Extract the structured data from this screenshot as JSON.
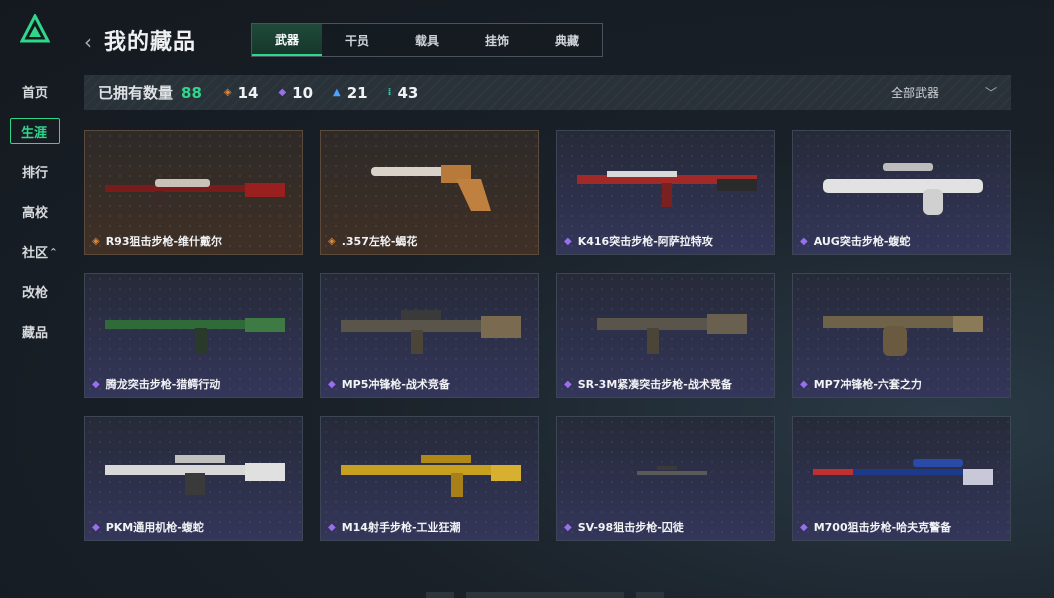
{
  "header": {
    "title": "我的藏品",
    "tabs": [
      {
        "label": "武器",
        "active": true
      },
      {
        "label": "干员",
        "active": false
      },
      {
        "label": "载具",
        "active": false
      },
      {
        "label": "挂饰",
        "active": false
      },
      {
        "label": "典藏",
        "active": false
      }
    ]
  },
  "sidebar": {
    "items": [
      {
        "label": "首页"
      },
      {
        "label": "生涯",
        "active": true
      },
      {
        "label": "排行"
      },
      {
        "label": "高校"
      },
      {
        "label": "社区",
        "caret": "^"
      },
      {
        "label": "改枪"
      },
      {
        "label": "藏品"
      }
    ]
  },
  "stats": {
    "label": "已拥有数量",
    "total": "88",
    "counts": [
      {
        "icon": "orange-diamond-icon",
        "value": "14",
        "color": "#e08a3c"
      },
      {
        "icon": "purple-diamond-icon",
        "value": "10",
        "color": "#9a6ef0"
      },
      {
        "icon": "blue-chevron-icon",
        "value": "21",
        "color": "#4aa3ff"
      },
      {
        "icon": "teal-dots-icon",
        "value": "43",
        "color": "#2fd7c0"
      }
    ],
    "filter": "全部武器"
  },
  "items": [
    {
      "name": "R93狙击步枪-维什戴尔",
      "rarity": "gold"
    },
    {
      "name": ".357左轮-蝎花",
      "rarity": "gold"
    },
    {
      "name": "K416突击步枪-阿萨拉特攻",
      "rarity": "purple"
    },
    {
      "name": "AUG突击步枪-蝮蛇",
      "rarity": "purple"
    },
    {
      "name": "腾龙突击步枪-猎鳄行动",
      "rarity": "purple"
    },
    {
      "name": "MP5冲锋枪-战术竞备",
      "rarity": "purple"
    },
    {
      "name": "SR-3M紧凑突击步枪-战术竞备",
      "rarity": "purple"
    },
    {
      "name": "MP7冲锋枪-六套之力",
      "rarity": "purple"
    },
    {
      "name": "PKM通用机枪-蝮蛇",
      "rarity": "purple"
    },
    {
      "name": "M14射手步枪-工业狂潮",
      "rarity": "purple"
    },
    {
      "name": "SV-98狙击步枪-囚徒",
      "rarity": "purple"
    },
    {
      "name": "M700狙击步枪-哈夫克警备",
      "rarity": "purple"
    }
  ],
  "colors": {
    "accent": "#2fd78a",
    "gold": "#e08a3c",
    "purple": "#9a6ef0"
  }
}
